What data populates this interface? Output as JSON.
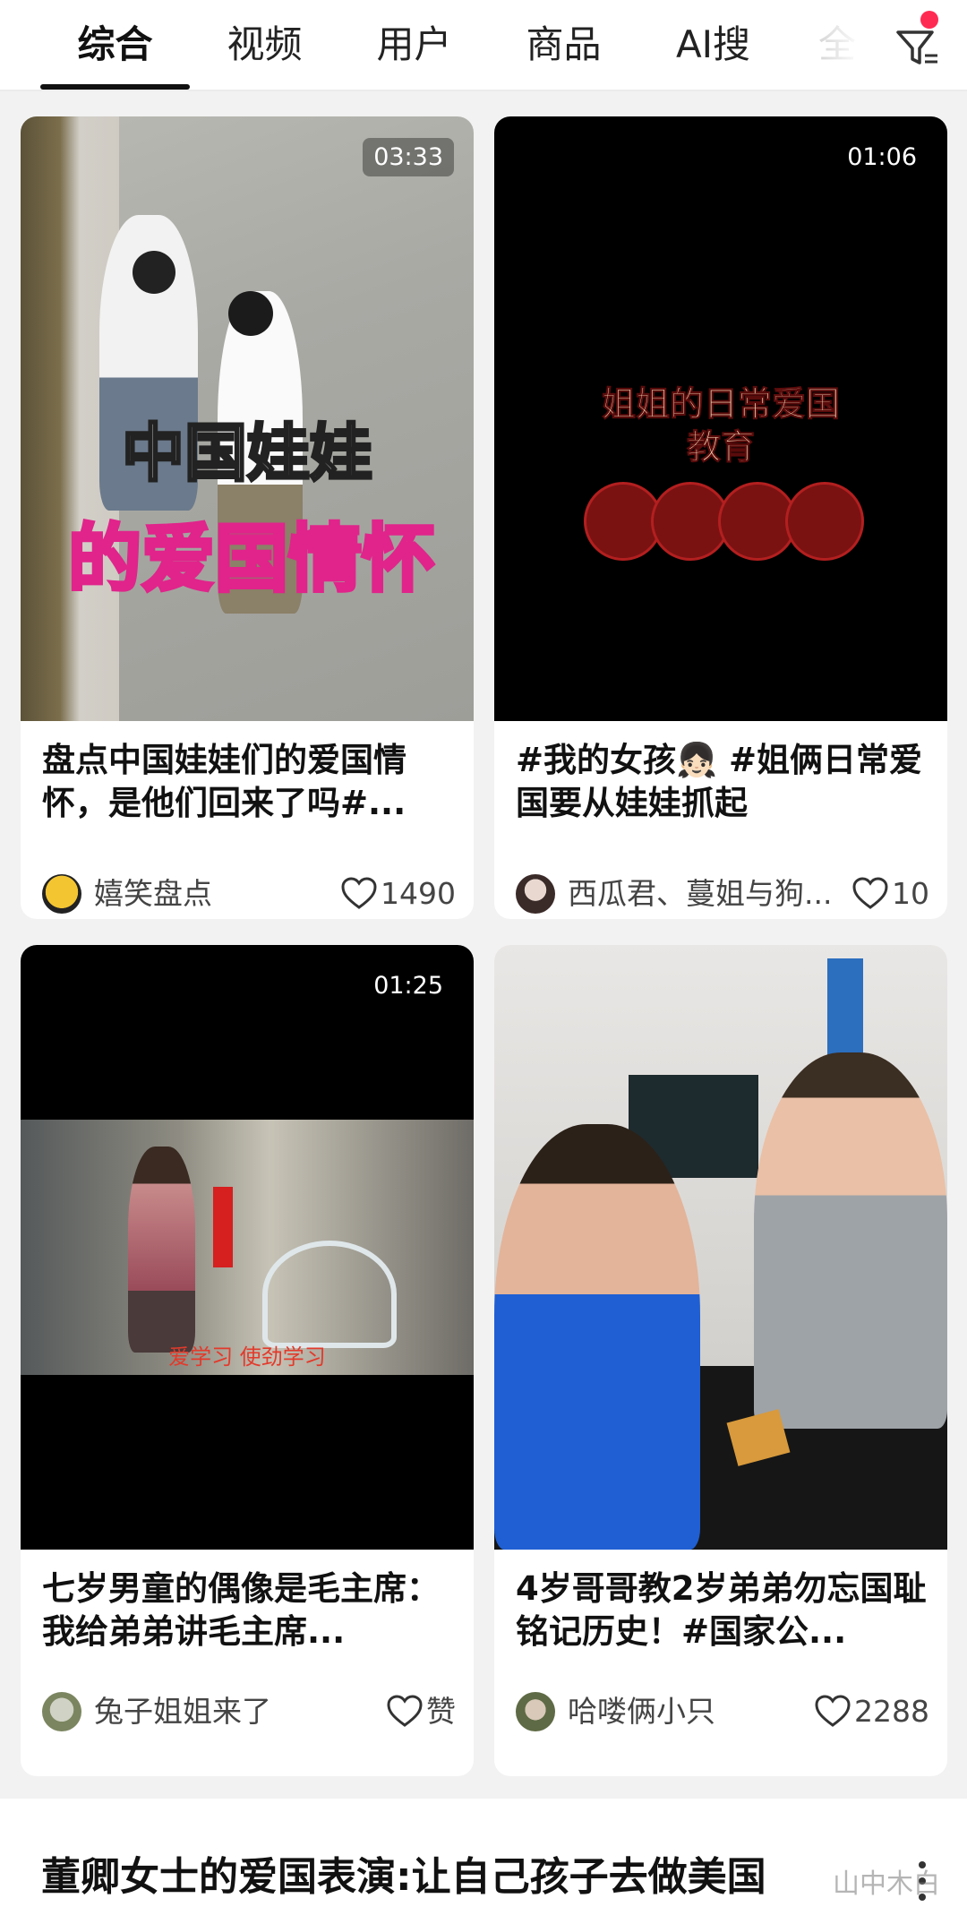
{
  "tabs": [
    {
      "label": "综合",
      "active": true
    },
    {
      "label": "视频"
    },
    {
      "label": "用户"
    },
    {
      "label": "商品"
    },
    {
      "label": "AI搜"
    },
    {
      "label": "全"
    }
  ],
  "filter": {
    "icon": "filter-icon",
    "badge_color": "#ff2a52"
  },
  "cards": [
    {
      "duration": "03:33",
      "thumb_caption_1": "中国娃娃",
      "thumb_caption_2": "的爱国情怀",
      "title": "盘点中国娃娃们的爱国情怀，是他们回来了吗#...",
      "author": "嬉笑盘点",
      "likes": "1490"
    },
    {
      "duration": "01:06",
      "thumb_caption_1": "姐姐的日常爱国",
      "thumb_caption_2": "教育",
      "title": "#我的女孩👧🏻 #姐俩日常爱国要从娃娃抓起",
      "author": "西瓜君、蔓姐与狗...",
      "likes": "10"
    },
    {
      "duration": "01:25",
      "thumb_caption_1": "爱学习 使劲学习",
      "title": "七岁男童的偶像是毛主席：我给弟弟讲毛主席...",
      "author": "兔子姐姐来了",
      "likes": "赞"
    },
    {
      "title": "4岁哥哥教2岁弟弟勿忘国耻铭记历史！#国家公...",
      "author": "哈喽俩小只",
      "likes": "2288"
    }
  ],
  "article": {
    "title": "董卿女士的爱国表演:让自己孩子去做美国"
  },
  "watermark": "山中木白"
}
